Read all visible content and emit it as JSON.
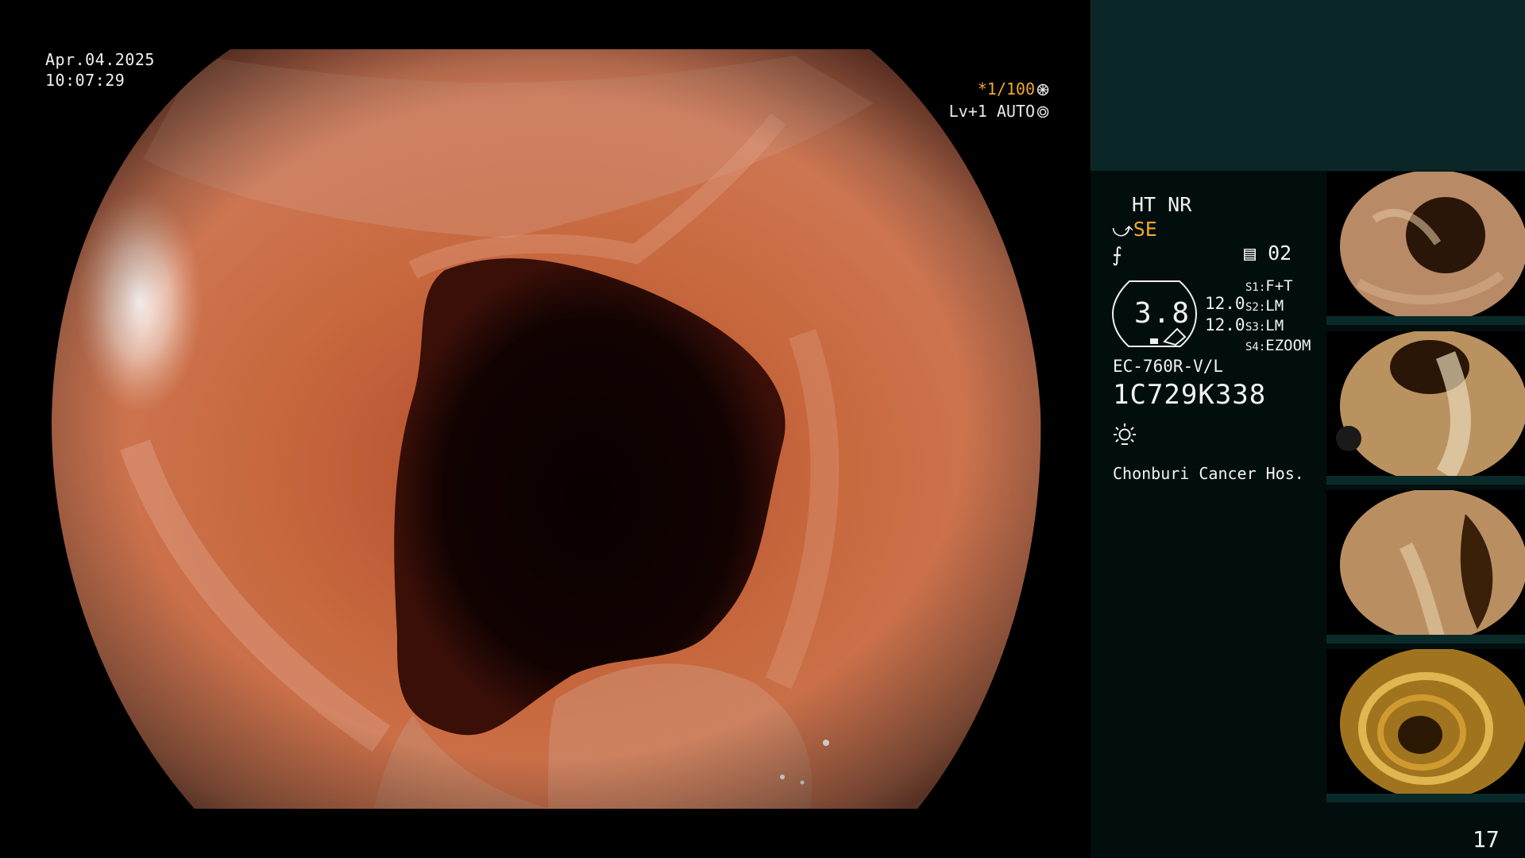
{
  "screen": {
    "date": "Apr.04.2025",
    "time": "10:07:29",
    "shutter": "*1/100",
    "shutter_icon": "shutter-icon",
    "level": "Lv+1",
    "exposure_mode": "AUTO",
    "exposure_icon": "auto-iris-icon"
  },
  "panel": {
    "ht_nr": "HT NR",
    "se_label": "SE",
    "structure_icon": "structure-enhance-icon",
    "contrast_icon": "contrast-icon",
    "memory_icon": "memory-card-icon",
    "memory_value": "02",
    "iris_value": "3.8",
    "gain_1": "12.0",
    "gain_2": "12.0",
    "switches": [
      {
        "key": "S1:",
        "value": "F+T"
      },
      {
        "key": "S2:",
        "value": "LM"
      },
      {
        "key": "S3:",
        "value": "LM"
      },
      {
        "key": "S4:",
        "value": "EZOOM"
      }
    ],
    "scope_model": "EC-760R-V/L",
    "scope_serial": "1C729K338",
    "light_icon": "light-source-icon",
    "hospital": "Chonburi Cancer Hos.",
    "page_number": "17",
    "accent_color": "#f0a830"
  },
  "thumbnails": [
    {
      "name": "colon-capture-1",
      "tone": "#b88a66"
    },
    {
      "name": "colon-capture-2",
      "tone": "#b99260"
    },
    {
      "name": "colon-capture-3",
      "tone": "#b98f62"
    },
    {
      "name": "colon-capture-4",
      "tone": "#a0741e"
    }
  ]
}
